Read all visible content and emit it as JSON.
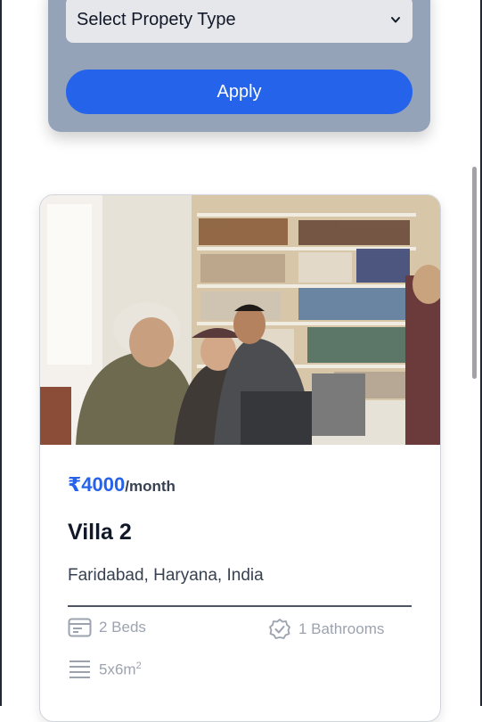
{
  "filter": {
    "property_type": "Select Propety Type",
    "apply_label": "Apply"
  },
  "listing": {
    "price": "₹4000",
    "period": "/month",
    "title": "Villa 2",
    "location": "Faridabad, Haryana, India",
    "beds": "2 Beds",
    "bathrooms": "1 Bathrooms",
    "size": "5x6m",
    "size_exponent": "2"
  },
  "icons": {
    "chevron": "chevron-down-icon",
    "beds": "bed-card-icon",
    "bathrooms": "badge-check-icon",
    "size": "lines-icon"
  },
  "colors": {
    "accent": "#2563eb",
    "panel": "#94a3b8",
    "muted": "#9ca3af"
  }
}
